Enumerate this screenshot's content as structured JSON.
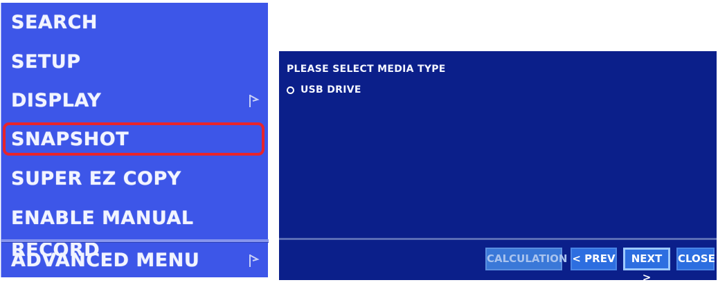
{
  "menu": {
    "items": [
      {
        "label": "SEARCH",
        "has_submenu": false
      },
      {
        "label": "SETUP",
        "has_submenu": false
      },
      {
        "label": "DISPLAY",
        "has_submenu": true
      },
      {
        "label": "SNAPSHOT",
        "has_submenu": false,
        "highlighted": true
      },
      {
        "label": "SUPER EZ COPY",
        "has_submenu": false
      },
      {
        "label": "ENABLE MANUAL RECORD",
        "has_submenu": false
      },
      {
        "label": "ADVANCED MENU",
        "has_submenu": true
      }
    ],
    "highlight_color": "#e8242b",
    "background_color": "#3d56e8"
  },
  "dialog": {
    "prompt": "PLEASE SELECT MEDIA TYPE",
    "options": [
      {
        "label": "USB DRIVE",
        "icon": "radio-icon"
      }
    ],
    "buttons": {
      "calculation": "CALCULATION",
      "prev": "< PREV",
      "next": "NEXT >",
      "close": "CLOSE"
    },
    "background_color": "#0b1f8a"
  }
}
